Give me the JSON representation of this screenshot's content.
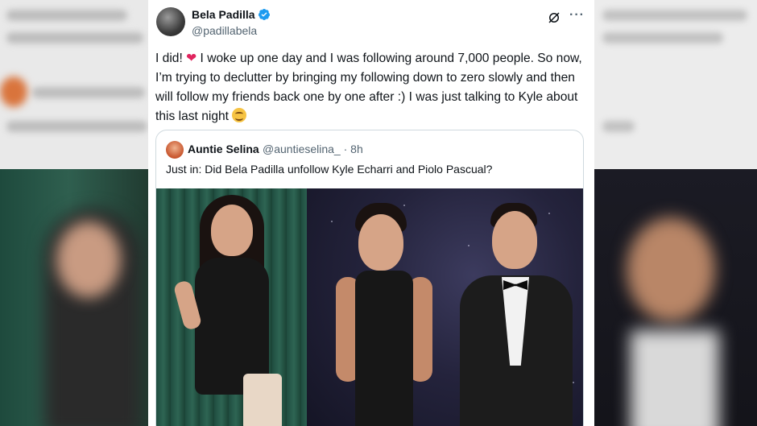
{
  "tweet": {
    "author": {
      "display_name": "Bela Padilla",
      "handle": "@padillabela",
      "verified": true
    },
    "text_part1": "I did! ",
    "heart_emoji": "❤",
    "text_part2": " I woke up one day and I was following around 7,000 people. So now, I’m trying to declutter by bringing my following down to zero slowly and then will follow my friends back one by one after :) I was just talking to Kyle about this last night ",
    "trailing_emoji_icon": "smiling-face-icon",
    "icons": {
      "grok": "grok-icon",
      "more": "more-icon"
    }
  },
  "quoted_tweet": {
    "display_name": "Auntie Selina",
    "handle_time": "@auntieselina_ · 8h",
    "text": "Just in: Did Bela Padilla unfollow Kyle Echarri and Piolo Pascual?"
  },
  "colors": {
    "verified_blue": "#1d9bf0",
    "text_primary": "#0f1419",
    "text_secondary": "#536471",
    "heart": "#e0245e"
  }
}
